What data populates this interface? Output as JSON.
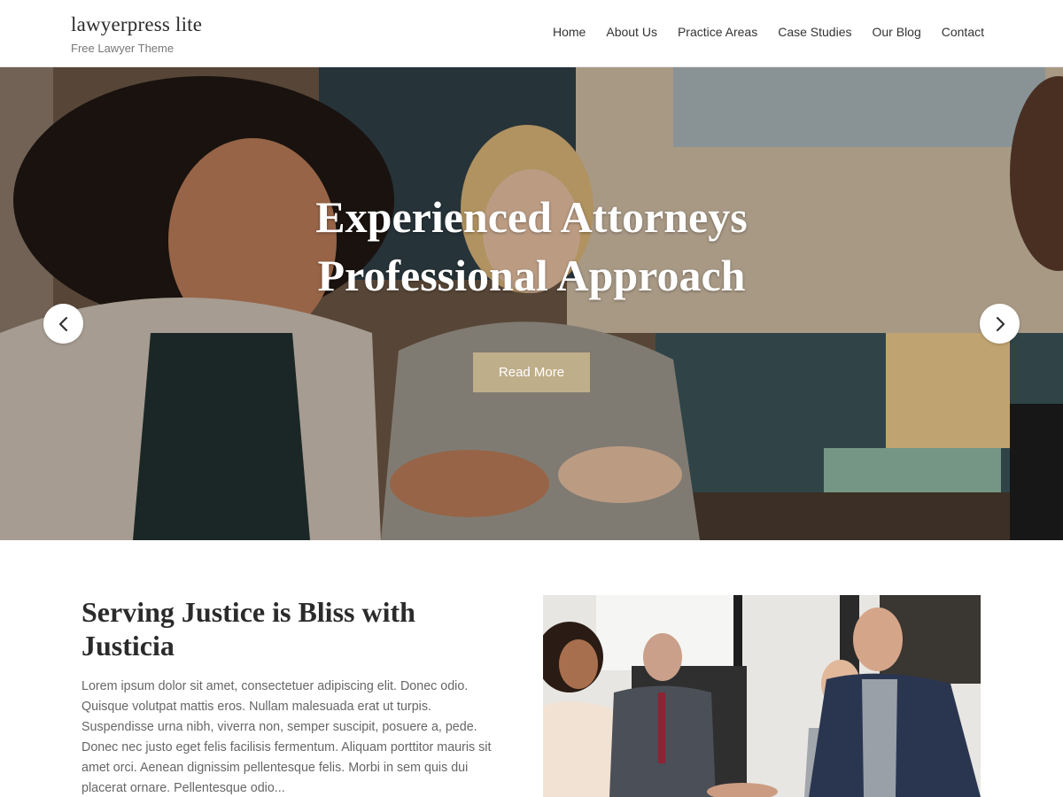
{
  "header": {
    "site_title": "lawyerpress lite",
    "tagline": "Free Lawyer Theme",
    "nav": [
      {
        "label": "Home"
      },
      {
        "label": "About Us"
      },
      {
        "label": "Practice Areas"
      },
      {
        "label": "Case Studies"
      },
      {
        "label": "Our Blog"
      },
      {
        "label": "Contact"
      }
    ]
  },
  "hero": {
    "heading_line1": "Experienced Attorneys",
    "heading_line2": "Professional Approach",
    "button_label": "Read More",
    "prev_icon": "chevron-left-icon",
    "next_icon": "chevron-right-icon"
  },
  "about": {
    "title": "Serving Justice is Bliss with Justicia",
    "text": "Lorem ipsum dolor sit amet, consectetuer adipiscing elit. Donec odio. Quisque volutpat mattis eros. Nullam malesuada erat ut turpis. Suspendisse urna nibh, viverra non, semper suscipit, posuere a, pede. Donec nec justo eget felis facilisis fermentum. Aliquam porttitor mauris sit amet orci. Aenean dignissim pellentesque felis. Morbi in sem quis dui placerat ornare. Pellentesque odio..."
  },
  "colors": {
    "accent": "#bfae8a",
    "heading": "#2b2b2b",
    "body_text": "#666666"
  }
}
